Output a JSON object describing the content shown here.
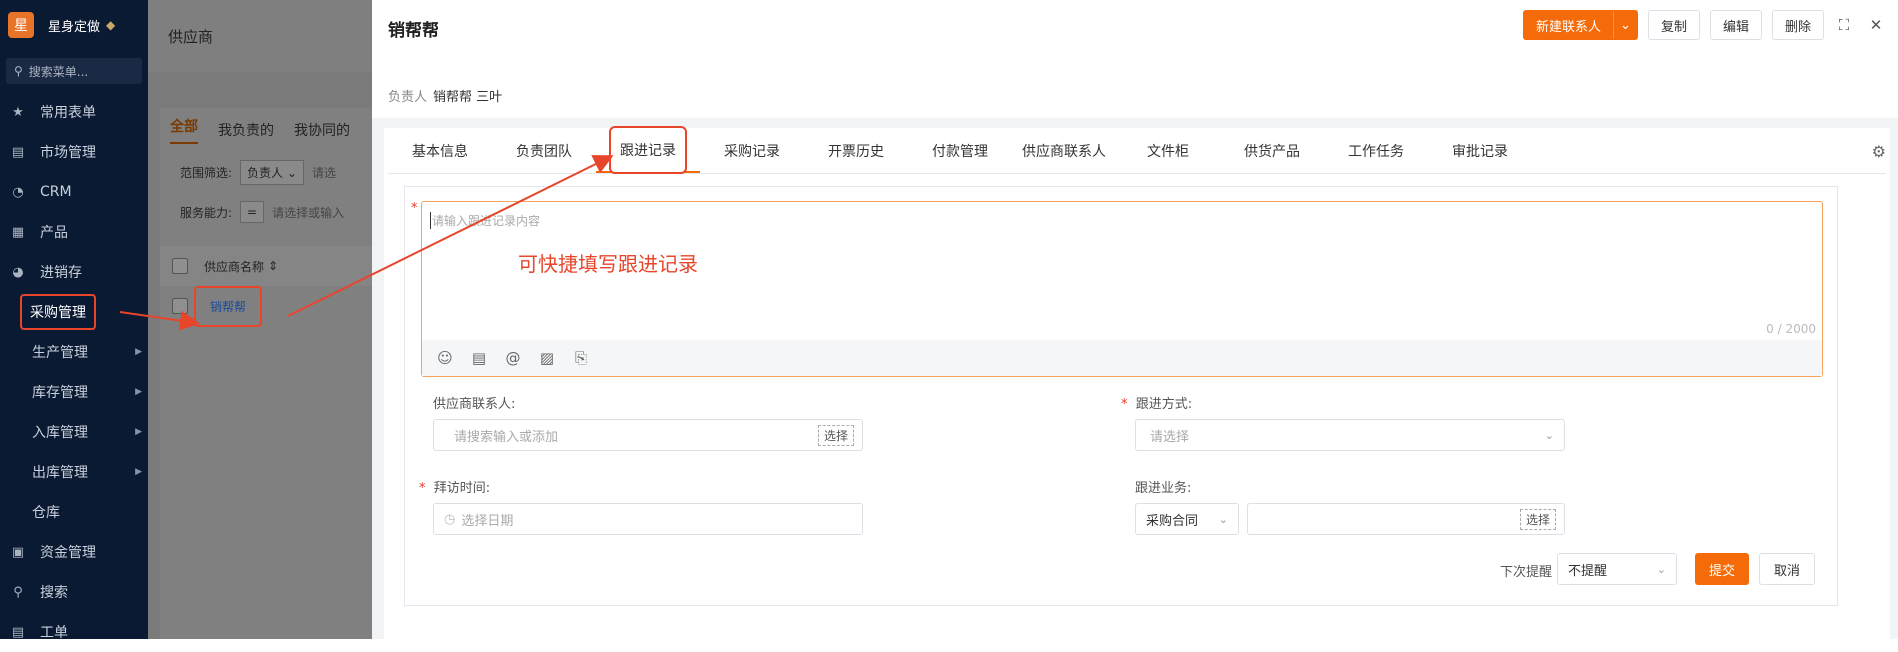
{
  "brand": {
    "logo": "星",
    "name": "星身定做"
  },
  "sidebar": {
    "search_placeholder": "搜索菜单...",
    "items": [
      {
        "label": "常用表单",
        "icon": "star-icon",
        "glyph": "★"
      },
      {
        "label": "市场管理",
        "icon": "clipboard-icon",
        "glyph": "▤"
      },
      {
        "label": "CRM",
        "icon": "pie-chart-icon",
        "glyph": "◔"
      },
      {
        "label": "产品",
        "icon": "grid-icon",
        "glyph": "▦"
      },
      {
        "label": "进销存",
        "icon": "gauge-icon",
        "glyph": "◕"
      }
    ],
    "sub_items": [
      {
        "label": "采购管理"
      },
      {
        "label": "生产管理"
      },
      {
        "label": "库存管理"
      },
      {
        "label": "入库管理"
      },
      {
        "label": "出库管理"
      },
      {
        "label": "仓库"
      }
    ],
    "bottom_items": [
      {
        "label": "资金管理",
        "icon": "money-icon",
        "glyph": "▣"
      },
      {
        "label": "搜索",
        "icon": "search-icon",
        "glyph": "⚲"
      },
      {
        "label": "工单",
        "icon": "ticket-icon",
        "glyph": "▤"
      }
    ]
  },
  "list": {
    "title": "供应商",
    "tabs": [
      "全部",
      "我负责的",
      "我协同的"
    ],
    "filter_label": "范围筛选:",
    "filter_value": "负责人",
    "filter_placeholder": "请选",
    "service_label": "服务能力:",
    "service_op": "=",
    "service_placeholder": "请选择或输入",
    "col_name": "供应商名称",
    "row_name": "销帮帮"
  },
  "detail": {
    "title": "销帮帮",
    "actions": {
      "new_contact": "新建联系人",
      "copy": "复制",
      "edit": "编辑",
      "delete": "删除"
    },
    "owner_label": "负责人",
    "owner_value": "销帮帮 三叶",
    "tabs": [
      "基本信息",
      "负责团队",
      "跟进记录",
      "采购记录",
      "开票历史",
      "付款管理",
      "供应商联系人",
      "文件柜",
      "供货产品",
      "工作任务",
      "审批记录"
    ],
    "active_tab": "跟进记录",
    "form": {
      "content_placeholder": "请输入跟进记录内容",
      "annotation": "可快捷填写跟进记录",
      "char_count": "0 / 2000",
      "contact_label": "供应商联系人:",
      "contact_placeholder": "请搜索输入或添加",
      "contact_select": "选择",
      "method_label": "跟进方式:",
      "method_placeholder": "请选择",
      "visit_label": "拜访时间:",
      "visit_placeholder": "选择日期",
      "business_label": "跟进业务:",
      "business_type": "采购合同",
      "business_select": "选择",
      "reminder_label": "下次提醒",
      "reminder_value": "不提醒",
      "submit": "提交",
      "cancel": "取消"
    }
  },
  "colors": {
    "accent": "#f56b0a",
    "annotation": "#e8452b",
    "sidebar_bg": "#0b1a33"
  }
}
